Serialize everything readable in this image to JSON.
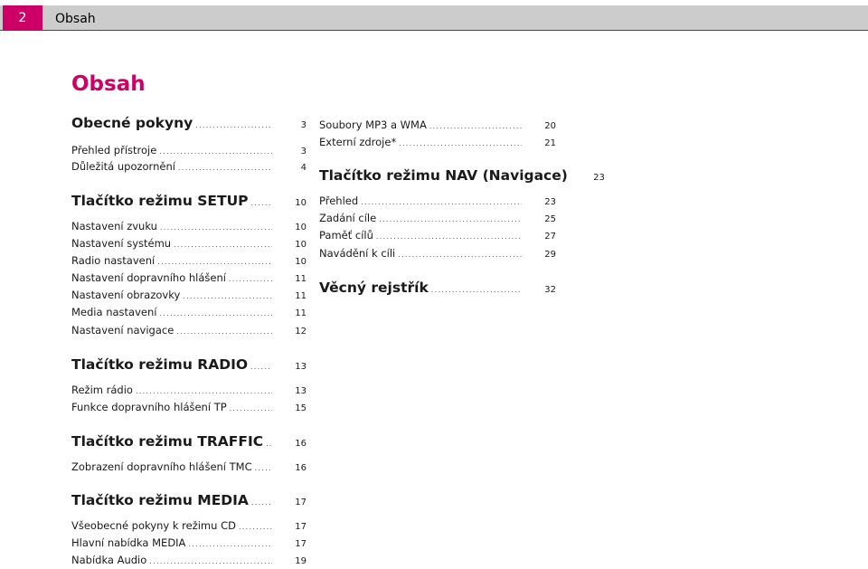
{
  "header": {
    "page_number": "2",
    "title": "Obsah"
  },
  "page_title": "Obsah",
  "colors": {
    "accent": "#cc0066",
    "header_bar": "#cccccc"
  },
  "toc_left": [
    {
      "kind": "section",
      "label": "Obecné pokyny",
      "page": "3"
    },
    {
      "kind": "entry",
      "label": "Přehled přístroje",
      "page": "3"
    },
    {
      "kind": "entry",
      "label": "Důležitá upozornění",
      "page": "4"
    },
    {
      "kind": "section",
      "label": "Tlačítko režimu SETUP",
      "page": "10"
    },
    {
      "kind": "entry",
      "label": "Nastavení zvuku",
      "page": "10"
    },
    {
      "kind": "entry",
      "label": "Nastavení systému",
      "page": "10"
    },
    {
      "kind": "entry",
      "label": "Radio nastavení",
      "page": "10"
    },
    {
      "kind": "entry",
      "label": "Nastavení dopravního hlášení",
      "page": "11"
    },
    {
      "kind": "entry",
      "label": "Nastavení obrazovky",
      "page": "11"
    },
    {
      "kind": "entry",
      "label": "Media nastavení",
      "page": "11"
    },
    {
      "kind": "entry",
      "label": "Nastavení navigace",
      "page": "12"
    },
    {
      "kind": "section",
      "label": "Tlačítko režimu RADIO",
      "page": "13"
    },
    {
      "kind": "entry",
      "label": "Režim rádio",
      "page": "13"
    },
    {
      "kind": "entry",
      "label": "Funkce dopravního hlášení TP",
      "page": "15"
    },
    {
      "kind": "section",
      "label": "Tlačítko režimu TRAFFIC",
      "page": "16"
    },
    {
      "kind": "entry",
      "label": "Zobrazení dopravního hlášení TMC",
      "page": "16"
    },
    {
      "kind": "section",
      "label": "Tlačítko režimu MEDIA",
      "page": "17"
    },
    {
      "kind": "entry",
      "label": "Všeobecné pokyny k režimu CD",
      "page": "17"
    },
    {
      "kind": "entry",
      "label": "Hlavní nabídka MEDIA",
      "page": "17"
    },
    {
      "kind": "entry",
      "label": "Nabídka Audio",
      "page": "19"
    }
  ],
  "toc_right": [
    {
      "kind": "entry",
      "label": "Soubory MP3 a WMA",
      "page": "20"
    },
    {
      "kind": "entry",
      "label": "Externí zdroje*",
      "page": "21"
    },
    {
      "kind": "section",
      "label": "Tlačítko režimu NAV (Navigace)",
      "page": "23"
    },
    {
      "kind": "entry",
      "label": "Přehled",
      "page": "23"
    },
    {
      "kind": "entry",
      "label": "Zadání cíle",
      "page": "25"
    },
    {
      "kind": "entry",
      "label": "Paměť cílů",
      "page": "27"
    },
    {
      "kind": "entry",
      "label": "Navádění k cíli",
      "page": "29"
    },
    {
      "kind": "section",
      "label": "Věcný rejstřík",
      "page": "32"
    }
  ]
}
